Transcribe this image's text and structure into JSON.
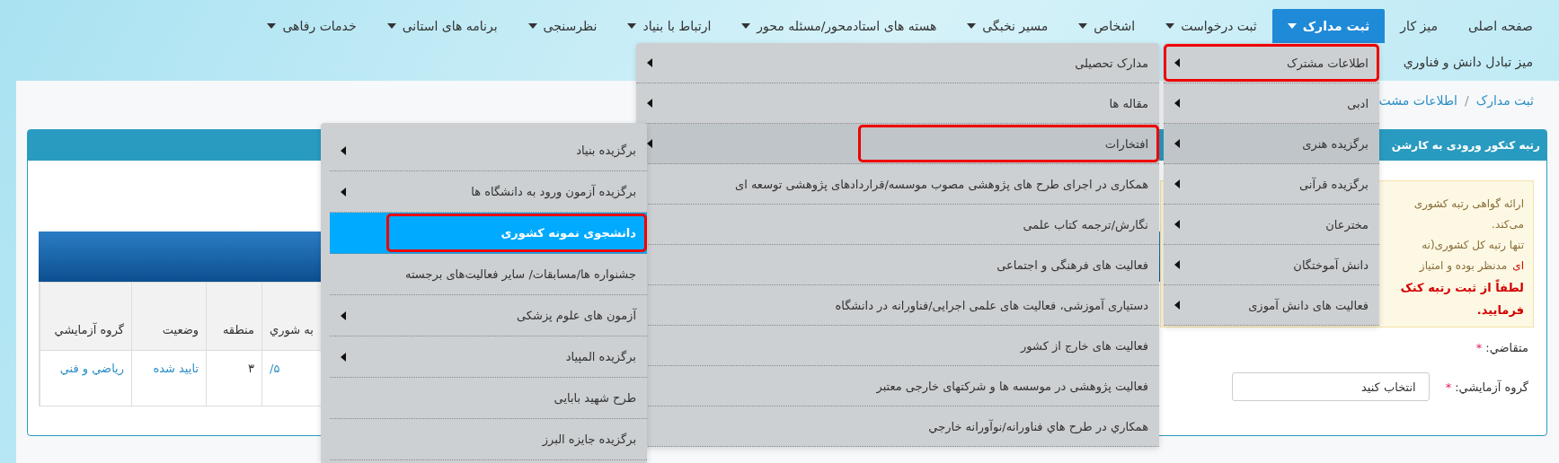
{
  "nav_row_1": [
    {
      "label": "صفحه اصلی",
      "dropdown": false,
      "selected": false
    },
    {
      "label": "میز کار",
      "dropdown": false,
      "selected": false
    },
    {
      "label": "ثبت مدارک",
      "dropdown": true,
      "selected": true
    },
    {
      "label": "ثبت درخواست",
      "dropdown": true,
      "selected": false
    },
    {
      "label": "اشخاص",
      "dropdown": true,
      "selected": false
    },
    {
      "label": "مسیر نخبگی",
      "dropdown": true,
      "selected": false
    },
    {
      "label": "هسته های استادمحور/مسئله محور",
      "dropdown": true,
      "selected": false
    },
    {
      "label": "ارتباط با بنیاد",
      "dropdown": true,
      "selected": false
    },
    {
      "label": "نظرسنجی",
      "dropdown": true,
      "selected": false
    },
    {
      "label": "برنامه های استانی",
      "dropdown": true,
      "selected": false
    },
    {
      "label": "خدمات رفاهی",
      "dropdown": true,
      "selected": false
    }
  ],
  "nav_row_2": [
    {
      "label": "میز تبادل دانش و فناوري",
      "dropdown": false,
      "selected": false
    }
  ],
  "breadcrumb": {
    "items": [
      "ثبت مدارک",
      "اطلاعات مشت"
    ],
    "separator": "/"
  },
  "panel": {
    "title": "رتبه کنکور ورودی به کارشن",
    "warning": {
      "lines": [
        {
          "kind": "note",
          "parts": [
            {
              "text": "ارائه گواهی رتبه کشوری",
              "alert": false
            }
          ]
        },
        {
          "kind": "note",
          "parts": [
            {
              "text": "می‌کند.",
              "alert": false
            }
          ]
        },
        {
          "kind": "note",
          "parts": [
            {
              "text": "تنها رتبه کل کشوری(نه",
              "alert": false
            }
          ]
        },
        {
          "kind": "note",
          "parts": [
            {
              "text": "ای",
              "alert": true
            },
            {
              "text": "مدنظر بوده و امتیاز",
              "alert": false
            }
          ]
        },
        {
          "kind": "alert",
          "parts": [
            {
              "text": "لطفاً از ثبت رتبه کنک",
              "alert": true
            }
          ]
        },
        {
          "kind": "alert",
          "parts": [
            {
              "text": "فرمایید.",
              "alert": true
            }
          ]
        }
      ]
    },
    "form": [
      {
        "label": "متقاضي:",
        "required_mark": "*"
      },
      {
        "label": "گروه آزمايشي:",
        "required_mark": "*",
        "value": "انتخاب کنید"
      }
    ],
    "table": {
      "columns": [
        {
          "label": "به شوري",
          "kind": "link"
        },
        {
          "label": "منطقه",
          "kind": "text"
        },
        {
          "label": "وضعیت",
          "kind": "link"
        },
        {
          "label": "گروه آزمايشي",
          "kind": "link"
        }
      ],
      "rows": [
        [
          "۵/",
          "۳",
          "تایید شده",
          "رياضي و فني"
        ]
      ]
    }
  },
  "menus": [
    {
      "items": [
        {
          "label": "اطلاعات مشترک",
          "submenu": true,
          "hovered": false,
          "selected": false,
          "highlighted": true
        },
        {
          "label": "ادبی",
          "submenu": true,
          "hovered": false,
          "selected": false,
          "highlighted": false
        },
        {
          "label": "برگزیده هنری",
          "submenu": true,
          "hovered": true,
          "selected": false,
          "highlighted": false
        },
        {
          "label": "برگزیده قرآنی",
          "submenu": true,
          "hovered": false,
          "selected": false,
          "highlighted": false
        },
        {
          "label": "مخترعان",
          "submenu": true,
          "hovered": false,
          "selected": false,
          "highlighted": false
        },
        {
          "label": "دانش آموختگان",
          "submenu": true,
          "hovered": false,
          "selected": false,
          "highlighted": false
        },
        {
          "label": "فعالیت های دانش آموزی",
          "submenu": true,
          "hovered": false,
          "selected": false,
          "highlighted": false
        }
      ]
    },
    {
      "items": [
        {
          "label": "مدارک تحصیلی",
          "submenu": true,
          "hovered": false,
          "selected": false,
          "highlighted": false
        },
        {
          "label": "مقاله ها",
          "submenu": true,
          "hovered": false,
          "selected": false,
          "highlighted": false
        },
        {
          "label": "افتخارات",
          "submenu": true,
          "hovered": true,
          "selected": false,
          "highlighted": true
        },
        {
          "label": "همکاری در اجرای طرح های پژوهشی مصوب موسسه/قراردادهای پژوهشی توسعه ای",
          "submenu": false,
          "hovered": false,
          "selected": false,
          "highlighted": false
        },
        {
          "label": "نگارش/ترجمه کتاب علمی",
          "submenu": false,
          "hovered": false,
          "selected": false,
          "highlighted": false
        },
        {
          "label": "فعالیت های فرهنگی و اجتماعی",
          "submenu": false,
          "hovered": false,
          "selected": false,
          "highlighted": false
        },
        {
          "label": "دستیاری آموزشی، فعالیت های علمی اجرایی/فناورانه در دانشگاه",
          "submenu": false,
          "hovered": false,
          "selected": false,
          "highlighted": false
        },
        {
          "label": "فعالیت های خارج از کشور",
          "submenu": false,
          "hovered": false,
          "selected": false,
          "highlighted": false
        },
        {
          "label": "فعالیت پژوهشی در موسسه ها و شرکتهای خارجی معتبر",
          "submenu": false,
          "hovered": false,
          "selected": false,
          "highlighted": false
        },
        {
          "label": "همکاري در طرح هاي فناورانه/نوآورانه خارجي",
          "submenu": false,
          "hovered": false,
          "selected": false,
          "highlighted": false
        }
      ]
    },
    {
      "items": [
        {
          "label": "برگزیده بنیاد",
          "submenu": true,
          "hovered": false,
          "selected": false,
          "highlighted": false
        },
        {
          "label": "برگزیده آزمون ورود به دانشگاه ها",
          "submenu": true,
          "hovered": false,
          "selected": false,
          "highlighted": false
        },
        {
          "label": "دانشجوی نمونه کشوری",
          "submenu": false,
          "hovered": false,
          "selected": true,
          "highlighted": true
        },
        {
          "label": "جشنواره ها/مسابقات/ سایر فعالیت‌های برجسته",
          "submenu": false,
          "hovered": false,
          "selected": false,
          "highlighted": false
        },
        {
          "label": "آزمون های علوم پزشکی",
          "submenu": true,
          "hovered": false,
          "selected": false,
          "highlighted": false
        },
        {
          "label": "برگزیده المپیاد",
          "submenu": true,
          "hovered": false,
          "selected": false,
          "highlighted": false
        },
        {
          "label": "طرح شهید بابایی",
          "submenu": false,
          "hovered": false,
          "selected": false,
          "highlighted": false
        },
        {
          "label": "برگزیده جایزه البرز",
          "submenu": false,
          "hovered": false,
          "selected": false,
          "highlighted": false
        }
      ]
    }
  ]
}
